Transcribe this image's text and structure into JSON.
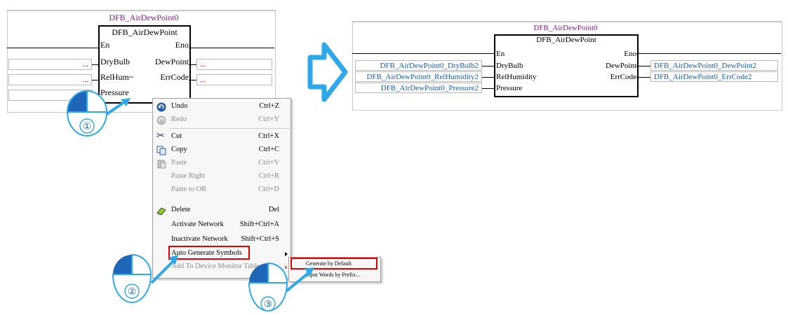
{
  "left_diagram": {
    "instance_name": "DFB_AirDewPoint0",
    "block_type": "DFB_AirDewPoint",
    "pins_left": [
      "En",
      "DryBulb",
      "RelHum~",
      "Pressure"
    ],
    "pins_right": [
      "Eno",
      "DewPoint",
      "ErrCode"
    ],
    "placeholder": "..."
  },
  "right_diagram": {
    "instance_name": "DFB_AirDewPoint0",
    "block_type": "DFB_AirDewPoint",
    "pins_left": [
      "En",
      "DryBulb",
      "RelHumidity",
      "Pressure"
    ],
    "pins_right": [
      "Eno",
      "DewPoint",
      "ErrCode"
    ],
    "inputs": [
      "DFB_AirDewPoint0_DryBulb2",
      "DFB_AirDewPoint0_RelHumidity2",
      "DFB_AirDewPoint0_Pressure2"
    ],
    "outputs": [
      "DFB_AirDewPoint0_DewPoint2",
      "DFB_AirDewPoint0_ErrCode2"
    ]
  },
  "context_menu": {
    "items": [
      {
        "label": "Undo",
        "shortcut": "Ctrl+Z",
        "icon": "undo-icon",
        "enabled": true
      },
      {
        "label": "Redo",
        "shortcut": "Ctrl+Y",
        "icon": "redo-icon",
        "enabled": false
      },
      {
        "label": "Cut",
        "shortcut": "Ctrl+X",
        "icon": "scissors-icon",
        "enabled": true
      },
      {
        "label": "Copy",
        "shortcut": "Ctrl+C",
        "icon": "copy-icon",
        "enabled": true
      },
      {
        "label": "Paste",
        "shortcut": "Ctrl+V",
        "icon": "paste-icon",
        "enabled": false
      },
      {
        "label": "Paste Right",
        "shortcut": "Ctrl+R",
        "enabled": false
      },
      {
        "label": "Paste to OR",
        "shortcut": "Ctrl+D",
        "enabled": false
      },
      {
        "label": "Delete",
        "shortcut": "Del",
        "icon": "eraser-icon",
        "enabled": true
      },
      {
        "label": "Activate Network",
        "shortcut": "Shift+Ctrl+A",
        "enabled": true
      },
      {
        "label": "Inactivate Network",
        "shortcut": "Shift+Ctrl+S",
        "enabled": true
      },
      {
        "label": "Auto Generate Symbols",
        "shortcut": "",
        "enabled": true
      },
      {
        "label": "Add To Device Monitor Table",
        "shortcut": "",
        "enabled": false
      }
    ]
  },
  "submenu": {
    "items": [
      "Generate by Default",
      "Input Words by Prefix..."
    ]
  },
  "steps": [
    "①",
    "②",
    "③"
  ],
  "colors": {
    "accent_blue": "#1f5aa8",
    "highlight_red": "#e00000",
    "instance_purple": "#7a1f7a",
    "arrow_blue": "#2ea8e8"
  }
}
